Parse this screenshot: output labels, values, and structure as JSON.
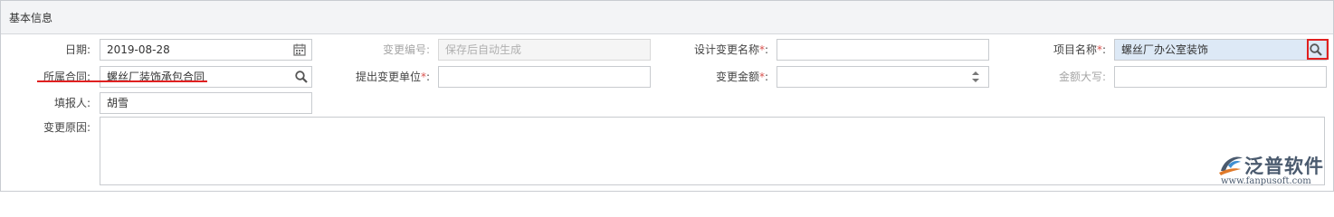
{
  "panel": {
    "title": "基本信息"
  },
  "fields": {
    "date": {
      "label": "日期:",
      "value": "2019-08-28",
      "icon": "calendar-icon"
    },
    "change_no": {
      "label": "变更编号:",
      "placeholder": "保存后自动生成"
    },
    "design_change_name": {
      "label": "设计变更名称",
      "required_mark": "*",
      "colon": ":",
      "value": ""
    },
    "project_name": {
      "label": "项目名称",
      "required_mark": "*",
      "colon": ":",
      "value": "螺丝厂办公室装饰",
      "icon": "search-icon"
    },
    "contract": {
      "label": "所属合同:",
      "value": "螺丝厂装饰承包合同",
      "icon": "search-icon"
    },
    "submit_unit": {
      "label": "提出变更单位",
      "required_mark": "*",
      "colon": ":",
      "value": ""
    },
    "change_amount": {
      "label": "变更金额",
      "required_mark": "*",
      "colon": ":",
      "value": "",
      "icon": "spinner-icon"
    },
    "amount_upper": {
      "label": "金额大写:",
      "value": ""
    },
    "reporter": {
      "label": "填报人:",
      "value": "胡雪"
    },
    "reason": {
      "label": "变更原因:",
      "value": ""
    }
  },
  "annotations": {
    "highlight_color": "#e02020"
  },
  "logo": {
    "text": "泛普软件",
    "url": "www.fanpusoft.com"
  }
}
